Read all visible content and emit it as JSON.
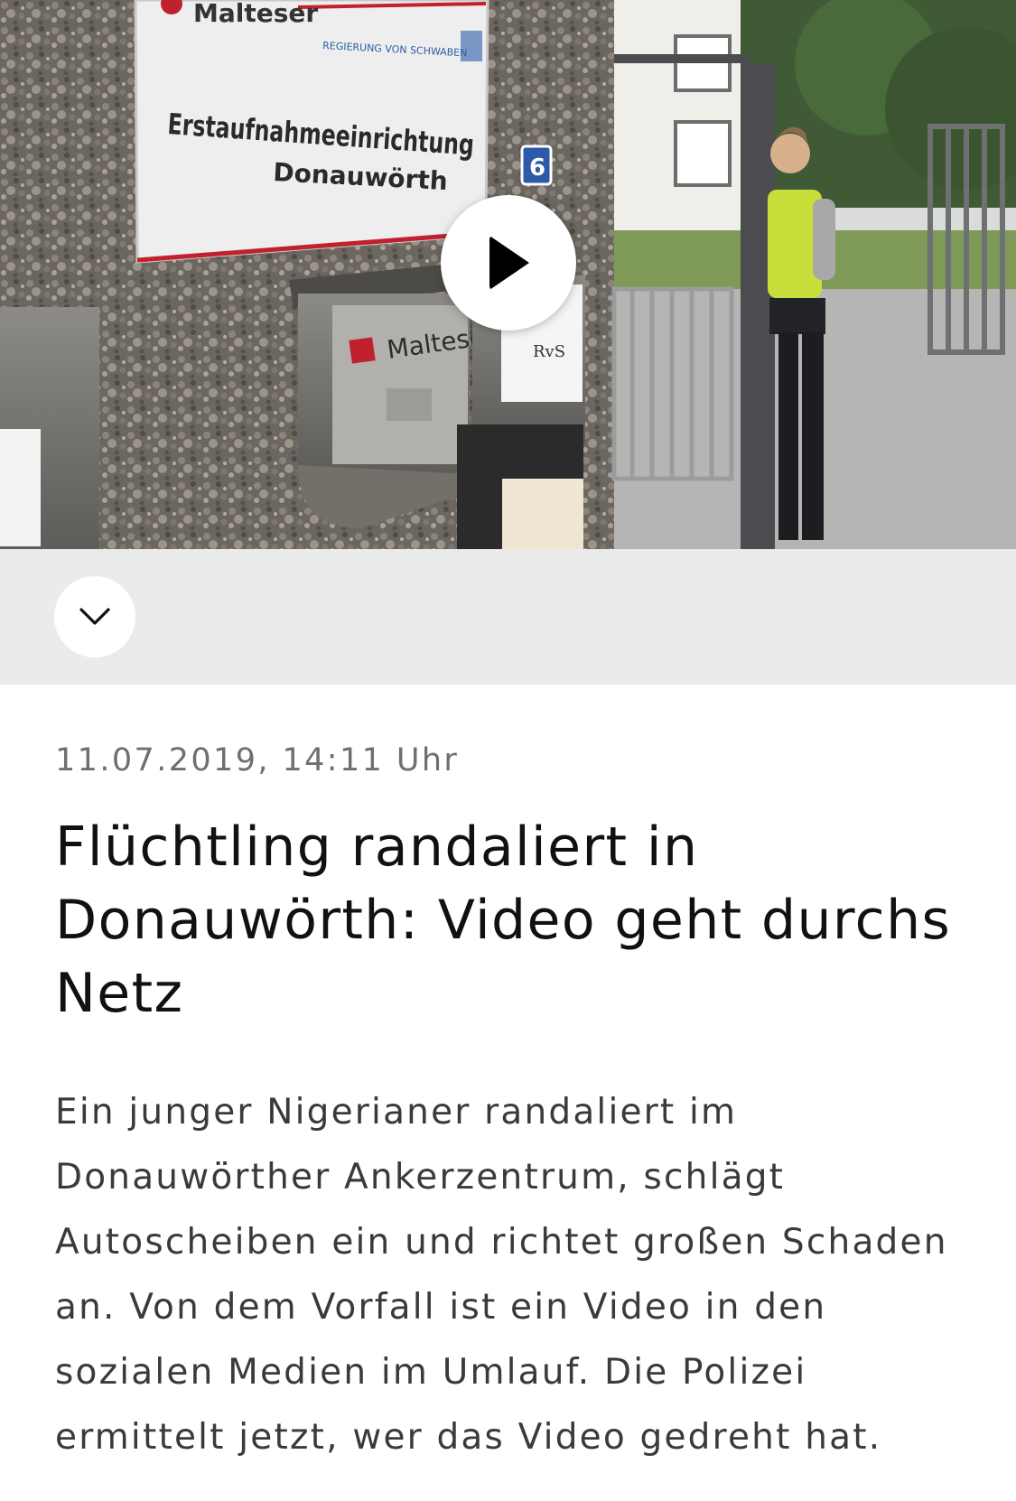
{
  "video": {
    "sign_brand": "Malteser",
    "sign_authority": "REGIERUNG VON SCHWABEN",
    "sign_title_line1": "Erstaufnahmeeinrichtung",
    "sign_title_line2": "Donauwörth",
    "house_number": "6",
    "mailbox_brand": "Malteser",
    "mailbox_label": "RvS",
    "play_icon": "play-icon"
  },
  "caption_bar": {
    "expand_icon": "chevron-down-icon"
  },
  "article": {
    "dateline": "11.07.2019, 14:11 Uhr",
    "headline": "Flüchtling randaliert in Donauwörth: Video geht durchs Netz",
    "teaser": "Ein junger Nigerianer randaliert im Donauwörther Ankerzentrum, schlägt Autoscheiben ein und richtet großen Schaden an. Von dem Vorfall ist ein Video in den sozialen Medien im Umlauf. Die Polizei ermittelt jetzt, wer das Video gedreht hat."
  },
  "colors": {
    "caption_bar_bg": "#ebebeb",
    "dateline": "#6f6f6f",
    "headline": "#111111",
    "teaser": "#3a3a3a"
  }
}
